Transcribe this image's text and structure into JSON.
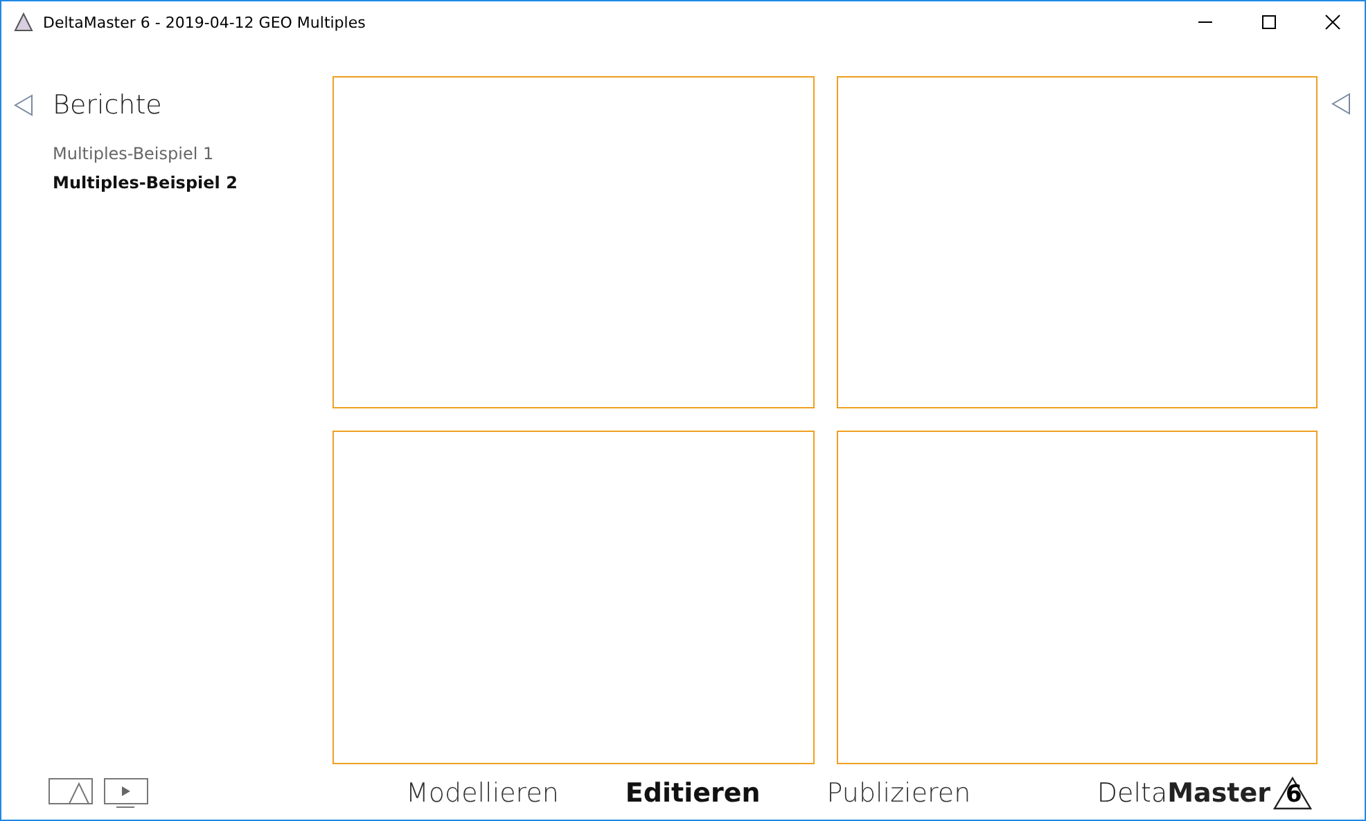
{
  "window": {
    "title": "DeltaMaster 6 - 2019-04-12 GEO Multiples"
  },
  "sidebar": {
    "title": "Berichte",
    "items": [
      {
        "label": "Multiples-Beispiel 1",
        "selected": false
      },
      {
        "label": "Multiples-Beispiel 2",
        "selected": true
      }
    ]
  },
  "panels": [
    {
      "kind": "empty"
    },
    {
      "kind": "empty"
    },
    {
      "kind": "empty"
    },
    {
      "kind": "empty"
    }
  ],
  "modes": [
    {
      "label": "Modellieren",
      "selected": false
    },
    {
      "label": "Editieren",
      "selected": true
    },
    {
      "label": "Publizieren",
      "selected": false
    }
  ],
  "brand": {
    "light": "Delta",
    "bold": "Master",
    "version": "6"
  }
}
